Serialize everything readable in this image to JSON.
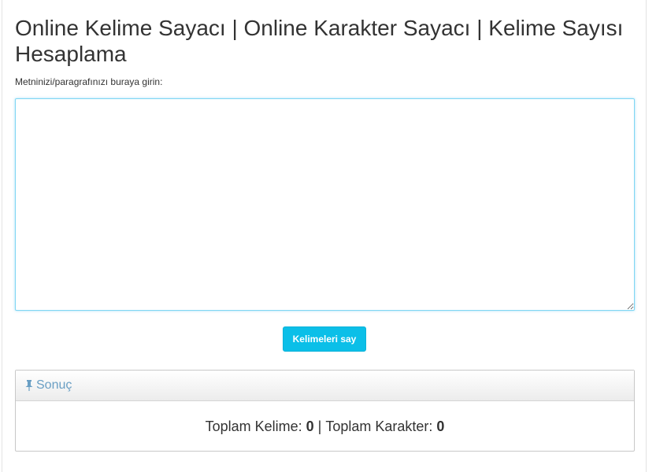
{
  "page": {
    "title": "Online Kelime Sayacı | Online Karakter Sayacı | Kelime Sayısı Hesaplama",
    "input_label": "Metninizi/paragrafınızı buraya girin:",
    "textarea_value": "",
    "count_button_label": "Kelimeleri say"
  },
  "result": {
    "heading": "Sonuç",
    "heading_icon": "pin-icon",
    "words_label": "Toplam Kelime:",
    "words_value": "0",
    "separator": "|",
    "chars_label": "Toplam Karakter:",
    "chars_value": "0"
  },
  "colors": {
    "button_bg": "#0bbfe8",
    "heading_text": "#6a9fc4",
    "textarea_focus_border": "#7fd6f3"
  }
}
